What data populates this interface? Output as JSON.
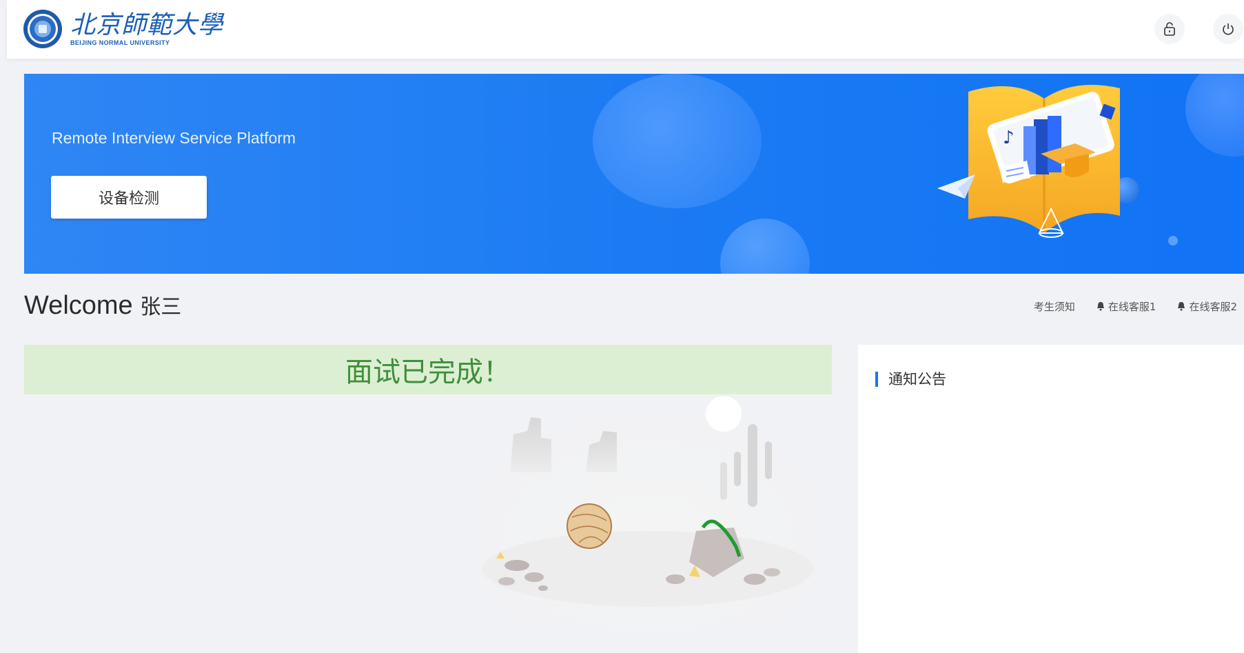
{
  "header": {
    "logo_cn": "北京師範大學",
    "logo_en": "BEIJING NORMAL UNIVERSITY",
    "icons": [
      "lock-icon",
      "power-icon"
    ]
  },
  "banner": {
    "subtitle": "Remote Interview Service Platform",
    "button_label": "设备检测"
  },
  "welcome": {
    "greeting": "Welcome",
    "user_name": "张三"
  },
  "quick_links": [
    {
      "label": "考生须知"
    },
    {
      "label": "在线客服1",
      "icon": "bell-icon"
    },
    {
      "label": "在线客服2",
      "icon": "bell-icon"
    }
  ],
  "status": {
    "message": "面试已完成！"
  },
  "notice": {
    "title": "通知公告"
  },
  "colors": {
    "brand": "#1c5fb8",
    "banner": "#1c7bf3",
    "success_bg": "#dcefd3",
    "success_text": "#3f8f3a"
  }
}
